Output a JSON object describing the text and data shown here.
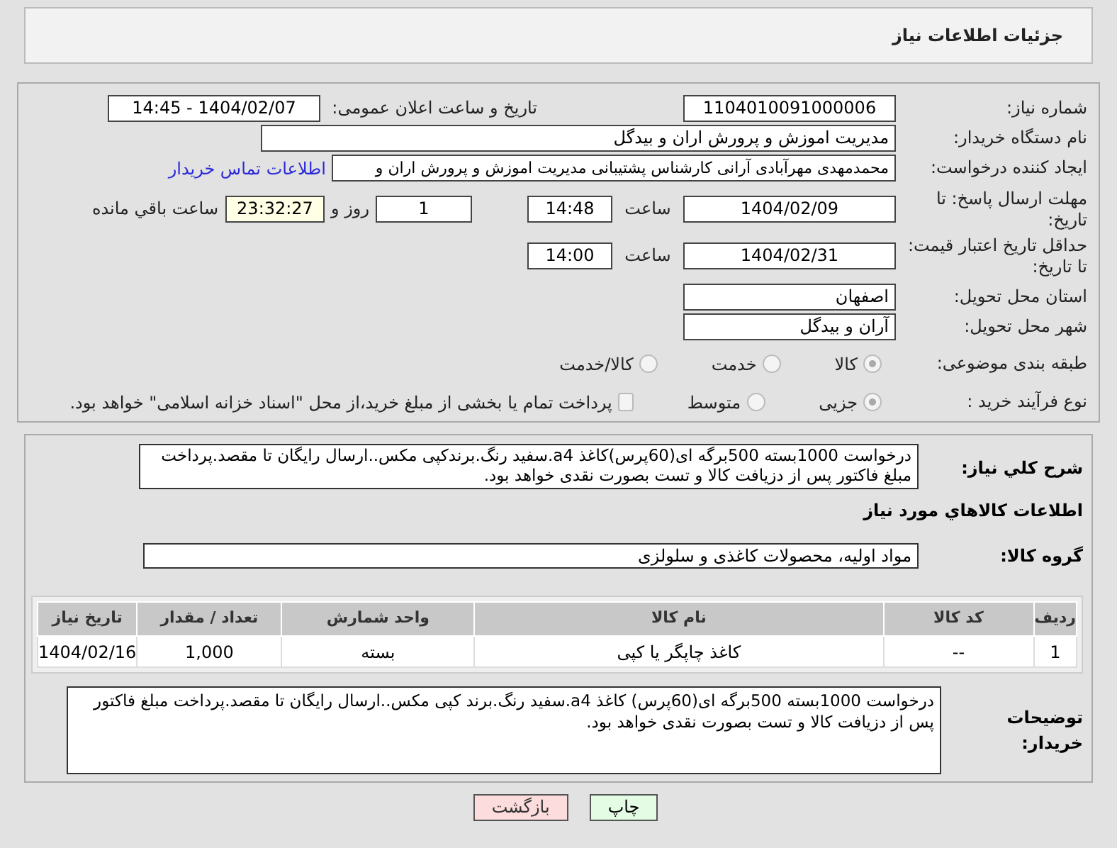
{
  "header": {
    "title": "جزئیات اطلاعات نیاز"
  },
  "need_number": {
    "label": "شماره نیاز:",
    "value": "1104010091000006"
  },
  "announce": {
    "label": "تاریخ و ساعت اعلان عمومی:",
    "value": "1404/02/07 - 14:45"
  },
  "buyer_org": {
    "label": "نام دستگاه خریدار:",
    "value": "مدیریت اموزش و پرورش اران و بیدگل"
  },
  "creator": {
    "label": "ایجاد کننده درخواست:",
    "value": "محمدمهدی مهرآبادی آرانی کارشناس پشتیبانی مدیریت اموزش و پرورش اران و",
    "link": "اطلاعات تماس خریدار"
  },
  "deadline": {
    "label": "مهلت ارسال پاسخ: تا تاریخ:",
    "date": "1404/02/09",
    "time_label": "ساعت",
    "time": "14:48",
    "days": "1",
    "days_label": "روز و",
    "remaining": "23:32:27",
    "remaining_label": "ساعت باقي مانده"
  },
  "validity": {
    "label": "حداقل تاریخ اعتبار قیمت: تا تاریخ:",
    "date": "1404/02/31",
    "time_label": "ساعت",
    "time": "14:00"
  },
  "province": {
    "label": "استان محل تحویل:",
    "value": "اصفهان"
  },
  "city": {
    "label": "شهر محل تحویل:",
    "value": "آران و بیدگل"
  },
  "category": {
    "label": "طبقه بندی موضوعی:",
    "options": [
      {
        "label": "کالا",
        "selected": true
      },
      {
        "label": "خدمت",
        "selected": false
      },
      {
        "label": "کالا/خدمت",
        "selected": false
      }
    ]
  },
  "process": {
    "label": "نوع فرآیند خرید :",
    "options": [
      {
        "label": "جزیی",
        "selected": true
      },
      {
        "label": "متوسط",
        "selected": false
      }
    ],
    "treasury": {
      "label": "پرداخت تمام یا بخشی از مبلغ خرید،از محل \"اسناد خزانه اسلامی\" خواهد بود.",
      "checked": false
    }
  },
  "summary": {
    "label": "شرح کلي نیاز:",
    "value": "درخواست 1000بسته 500برگه ای(60پرس)کاغذ a4.سفید رنگ.برندکپی مکس..ارسال رایگان تا مقصد.پرداخت مبلغ فاکتور پس از دزیافت کالا و تست بصورت نقدی خواهد بود."
  },
  "goods_heading": "اطلاعات کالاهاي مورد نياز",
  "goods_group": {
    "label": "گروه کالا:",
    "value": "مواد اولیه، محصولات کاغذی و سلولزی"
  },
  "table": {
    "columns": [
      "ردیف",
      "کد کالا",
      "نام کالا",
      "واحد شمارش",
      "تعداد / مقدار",
      "تاریخ نیاز"
    ],
    "rows": [
      [
        "1",
        "--",
        "کاغذ چاپگر یا کپی",
        "بسته",
        "1,000",
        "1404/02/16"
      ]
    ]
  },
  "buyer_notes": {
    "label": "توضیحات خریدار:",
    "value": "درخواست 1000بسته 500برگه ای(60پرس) کاغذ a4.سفید رنگ.برند کپی مکس..ارسال رایگان تا مقصد.پرداخت مبلغ فاکتور پس از دزیافت کالا و تست بصورت نقدی خواهد بود."
  },
  "buttons": [
    {
      "label": "چاپ",
      "kind": "print"
    },
    {
      "label": "بازگشت",
      "kind": "back"
    }
  ]
}
